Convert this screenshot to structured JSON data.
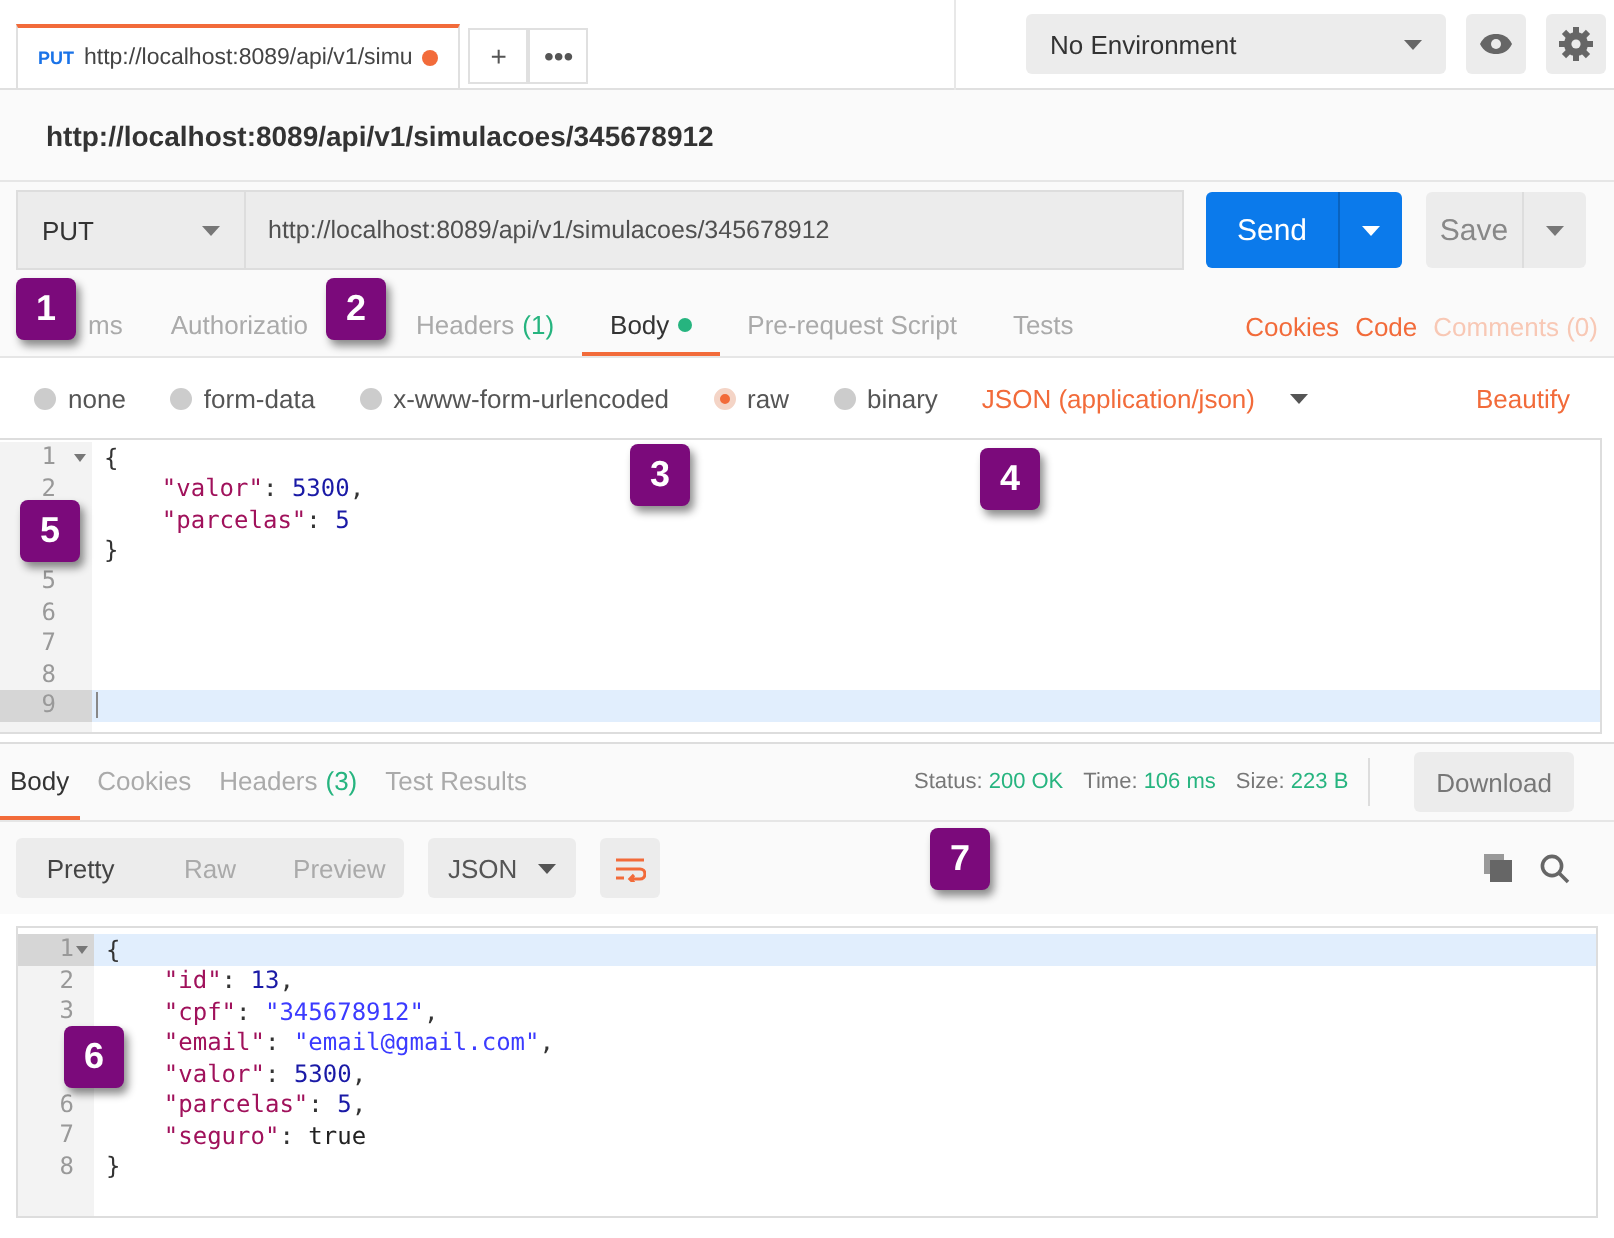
{
  "request_tab": {
    "method": "PUT",
    "title": "http://localhost:8089/api/v1/simu",
    "unsaved": true
  },
  "tab_actions": [
    "+",
    "•••"
  ],
  "environment": {
    "value": "No Environment"
  },
  "request_title": "http://localhost:8089/api/v1/simulacoes/345678912",
  "method": "PUT",
  "url": "http://localhost:8089/api/v1/simulacoes/345678912",
  "send_label": "Send",
  "save_label": "Save",
  "request_tabs": [
    {
      "label": "ms",
      "selected": false
    },
    {
      "label": "Authorizatio",
      "selected": false
    },
    {
      "label": "Headers",
      "count": "(1)",
      "selected": false
    },
    {
      "label": "Body",
      "dot": true,
      "selected": true
    },
    {
      "label": "Pre-request Script",
      "selected": false
    },
    {
      "label": "Tests",
      "selected": false
    }
  ],
  "request_links": [
    {
      "label": "Cookies",
      "disabled": false
    },
    {
      "label": "Code",
      "disabled": false
    },
    {
      "label": "Comments (0)",
      "disabled": true
    }
  ],
  "body_types": [
    {
      "label": "none",
      "selected": false
    },
    {
      "label": "form-data",
      "selected": false
    },
    {
      "label": "x-www-form-urlencoded",
      "selected": false
    },
    {
      "label": "raw",
      "selected": true
    },
    {
      "label": "binary",
      "selected": false
    }
  ],
  "content_type": "JSON (application/json)",
  "beautify": "Beautify",
  "request_body": [
    {
      "number": "1",
      "fold": true,
      "active": false,
      "tokens": [
        {
          "kind": "punct",
          "text": "{"
        }
      ]
    },
    {
      "number": "2",
      "active": false,
      "tokens": [
        {
          "kind": "key",
          "text": "    \"valor\""
        },
        {
          "kind": "punct",
          "text": ": "
        },
        {
          "kind": "number",
          "text": "5300"
        },
        {
          "kind": "punct",
          "text": ","
        }
      ]
    },
    {
      "active": false,
      "tokens": [
        {
          "kind": "key",
          "text": "    \"parcelas\""
        },
        {
          "kind": "punct",
          "text": ": "
        },
        {
          "kind": "number",
          "text": "5"
        }
      ]
    },
    {
      "active": false,
      "tokens": [
        {
          "kind": "punct",
          "text": "}"
        }
      ]
    },
    {
      "number": "5",
      "active": false
    },
    {
      "number": "6",
      "active": false
    },
    {
      "number": "7",
      "active": false
    },
    {
      "number": "8",
      "active": false
    },
    {
      "number": "9",
      "active": true
    }
  ],
  "response_tabs": [
    {
      "label": "Body",
      "selected": true
    },
    {
      "label": "Cookies",
      "selected": false
    },
    {
      "label": "Headers",
      "count": "(3)",
      "selected": false
    },
    {
      "label": "Test Results",
      "selected": false
    }
  ],
  "response_stats": [
    {
      "label": "Status:",
      "value": "200 OK"
    },
    {
      "label": "Time:",
      "value": "106 ms"
    },
    {
      "label": "Size:",
      "value": "223 B"
    }
  ],
  "download": "Download",
  "view_modes": [
    {
      "label": "Pretty",
      "selected": true
    },
    {
      "label": "Raw",
      "selected": false
    },
    {
      "label": "Preview",
      "selected": false
    }
  ],
  "format": "JSON",
  "response_body": [
    {
      "number": "1",
      "fold": true,
      "active": true,
      "tokens": [
        {
          "kind": "punct",
          "text": "{"
        }
      ]
    },
    {
      "number": "2",
      "active": false,
      "tokens": [
        {
          "kind": "key",
          "text": "    \"id\""
        },
        {
          "kind": "punct",
          "text": ": "
        },
        {
          "kind": "number",
          "text": "13"
        },
        {
          "kind": "punct",
          "text": ","
        }
      ]
    },
    {
      "number": "3",
      "active": false,
      "tokens": [
        {
          "kind": "key",
          "text": "    \"cpf\""
        },
        {
          "kind": "punct",
          "text": ": "
        },
        {
          "kind": "string",
          "text": "\"345678912\""
        },
        {
          "kind": "punct",
          "text": ","
        }
      ]
    },
    {
      "active": false,
      "tokens": [
        {
          "kind": "key",
          "text": "    \"email\""
        },
        {
          "kind": "punct",
          "text": ": "
        },
        {
          "kind": "string",
          "text": "\"email@gmail.com\""
        },
        {
          "kind": "punct",
          "text": ","
        }
      ]
    },
    {
      "active": false,
      "tokens": [
        {
          "kind": "key",
          "text": "    \"valor\""
        },
        {
          "kind": "punct",
          "text": ": "
        },
        {
          "kind": "number",
          "text": "5300"
        },
        {
          "kind": "punct",
          "text": ","
        }
      ]
    },
    {
      "number": "6",
      "active": false,
      "tokens": [
        {
          "kind": "key",
          "text": "    \"parcelas\""
        },
        {
          "kind": "punct",
          "text": ": "
        },
        {
          "kind": "number",
          "text": "5"
        },
        {
          "kind": "punct",
          "text": ","
        }
      ]
    },
    {
      "number": "7",
      "active": false,
      "tokens": [
        {
          "kind": "key",
          "text": "    \"seguro\""
        },
        {
          "kind": "punct",
          "text": ": "
        },
        {
          "kind": "bool",
          "text": "true"
        }
      ]
    },
    {
      "number": "8",
      "active": false,
      "tokens": [
        {
          "kind": "punct",
          "text": "}"
        }
      ]
    }
  ],
  "callouts": [
    "1",
    "2",
    "3",
    "4",
    "5",
    "6",
    "7"
  ]
}
